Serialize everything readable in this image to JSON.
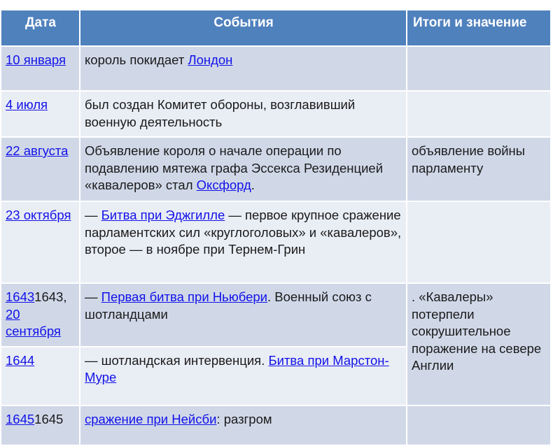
{
  "table": {
    "headers": [
      "Дата",
      "События",
      "Итоги и значение"
    ],
    "rows": [
      {
        "date": [
          {
            "text": "10 января",
            "link": true
          }
        ],
        "events": [
          {
            "text": "король покидает ",
            "link": false
          },
          {
            "text": "Лондон",
            "link": true
          }
        ],
        "result": ""
      },
      {
        "date": [
          {
            "text": "4 июля",
            "link": true
          }
        ],
        "events": [
          {
            "text": "был создан Комитет обороны, возглавивший военную деятельность",
            "link": false
          }
        ],
        "result": ""
      },
      {
        "date": [
          {
            "text": "22 августа",
            "link": true
          }
        ],
        "events": [
          {
            "text": "Объявление короля о начале операции по подавлению мятежа графа Эссекса Резиденцией «кавалеров» стал ",
            "link": false
          },
          {
            "text": "Оксфорд",
            "link": true
          },
          {
            "text": ".",
            "link": false
          }
        ],
        "result": "объявление войны парламенту"
      },
      {
        "date": [
          {
            "text": "23 октября",
            "link": true
          }
        ],
        "events": [
          {
            "text": "— ",
            "link": false
          },
          {
            "text": "Битва при Эджгилле",
            "link": true
          },
          {
            "text": " — первое крупное сражение парламентских сил «круглоголовых» и «кавалеров», второе — в ноябре при Тернем-Грин",
            "link": false
          }
        ],
        "result": ""
      },
      {
        "date": [
          {
            "text": "1643",
            "link": true
          },
          {
            "text": "1643",
            "link": false
          },
          {
            "text": ", ",
            "link": false
          },
          {
            "text": "20 сентября",
            "link": true
          }
        ],
        "events": [
          {
            "text": "— ",
            "link": false
          },
          {
            "text": "Первая битва при Ньюбери",
            "link": true
          },
          {
            "text": ". Военный союз с шотландцами",
            "link": false
          }
        ],
        "result": ". «Кавалеры» потерпели сокрушительное поражение на севере Англии"
      },
      {
        "date": [
          {
            "text": "1644",
            "link": true
          }
        ],
        "events": [
          {
            "text": "— шотландская интервенция. ",
            "link": false
          },
          {
            "text": "Битва при Марстон-Муре",
            "link": true
          }
        ],
        "result": null
      },
      {
        "date": [
          {
            "text": "1645",
            "link": true
          },
          {
            "text": "1645",
            "link": false
          }
        ],
        "events": [
          {
            "text": "сражение при Нейсби",
            "link": true
          },
          {
            "text": ": разгром",
            "link": false
          }
        ],
        "result": ""
      }
    ]
  }
}
